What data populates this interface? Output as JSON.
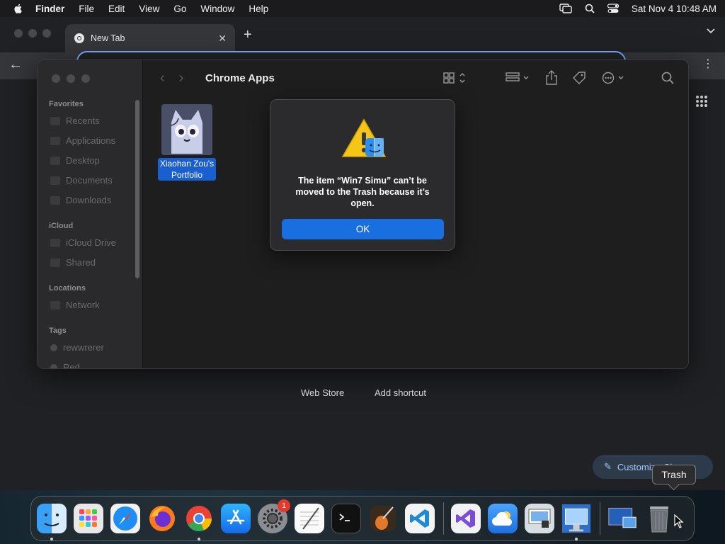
{
  "menubar": {
    "app_name": "Finder",
    "items": [
      "File",
      "Edit",
      "View",
      "Go",
      "Window",
      "Help"
    ],
    "clock": "Sat Nov 4  10:48 AM"
  },
  "chrome": {
    "tab_title": "New Tab",
    "new_tab_symbol": "+",
    "shortcuts": [
      "Web Store",
      "Add shortcut"
    ],
    "customize_label": "Customize Chrome"
  },
  "finder": {
    "title": "Chrome Apps",
    "sidebar": {
      "favorites_title": "Favorites",
      "favorites": [
        "Recents",
        "Applications",
        "Desktop",
        "Documents",
        "Downloads"
      ],
      "icloud_title": "iCloud",
      "icloud": [
        "iCloud Drive",
        "Shared"
      ],
      "locations_title": "Locations",
      "locations": [
        "Network"
      ],
      "tags_title": "Tags",
      "tags": [
        "rewwrerer",
        "Red"
      ]
    },
    "file": {
      "name_line1": "Xiaohan Zou's",
      "name_line2": "Portfolio"
    }
  },
  "alert": {
    "message": "The item “Win7 Simu” can’t be moved to the Trash because it’s open.",
    "ok_label": "OK"
  },
  "dock": {
    "apps": [
      "Finder",
      "Launchpad",
      "Safari",
      "Firefox",
      "Google Chrome",
      "App Store",
      "System Settings",
      "TextEdit",
      "Terminal",
      "GarageBand",
      "Visual Studio Code",
      "Visual Studio",
      "iCloud Weather",
      "Preview",
      "Win7 Simu",
      "Desktop",
      "Trash"
    ],
    "settings_badge": "1",
    "trash_tooltip": "Trash"
  },
  "colors": {
    "accent_blue": "#1a6fe0",
    "selection_blue": "#1a5fd0",
    "chrome_omnibox_border": "#7cacf8"
  }
}
